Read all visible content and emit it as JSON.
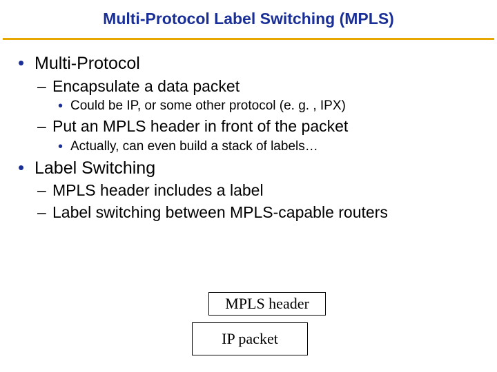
{
  "title": "Multi-Protocol Label Switching (MPLS)",
  "bullets": {
    "a": {
      "text": "Multi-Protocol",
      "sub": {
        "a1": {
          "text": "Encapsulate a data packet",
          "sub": {
            "a1a": "Could be IP, or some other protocol (e. g. , IPX)"
          }
        },
        "a2": {
          "text": "Put an MPLS header in front of the packet",
          "sub": {
            "a2a": "Actually, can even build a stack of labels…"
          }
        }
      }
    },
    "b": {
      "text": "Label Switching",
      "sub": {
        "b1": {
          "text": "MPLS header includes a label"
        },
        "b2": {
          "text": "Label switching between MPLS-capable routers"
        }
      }
    }
  },
  "diagram": {
    "top": "MPLS header",
    "bottom": "IP packet"
  }
}
